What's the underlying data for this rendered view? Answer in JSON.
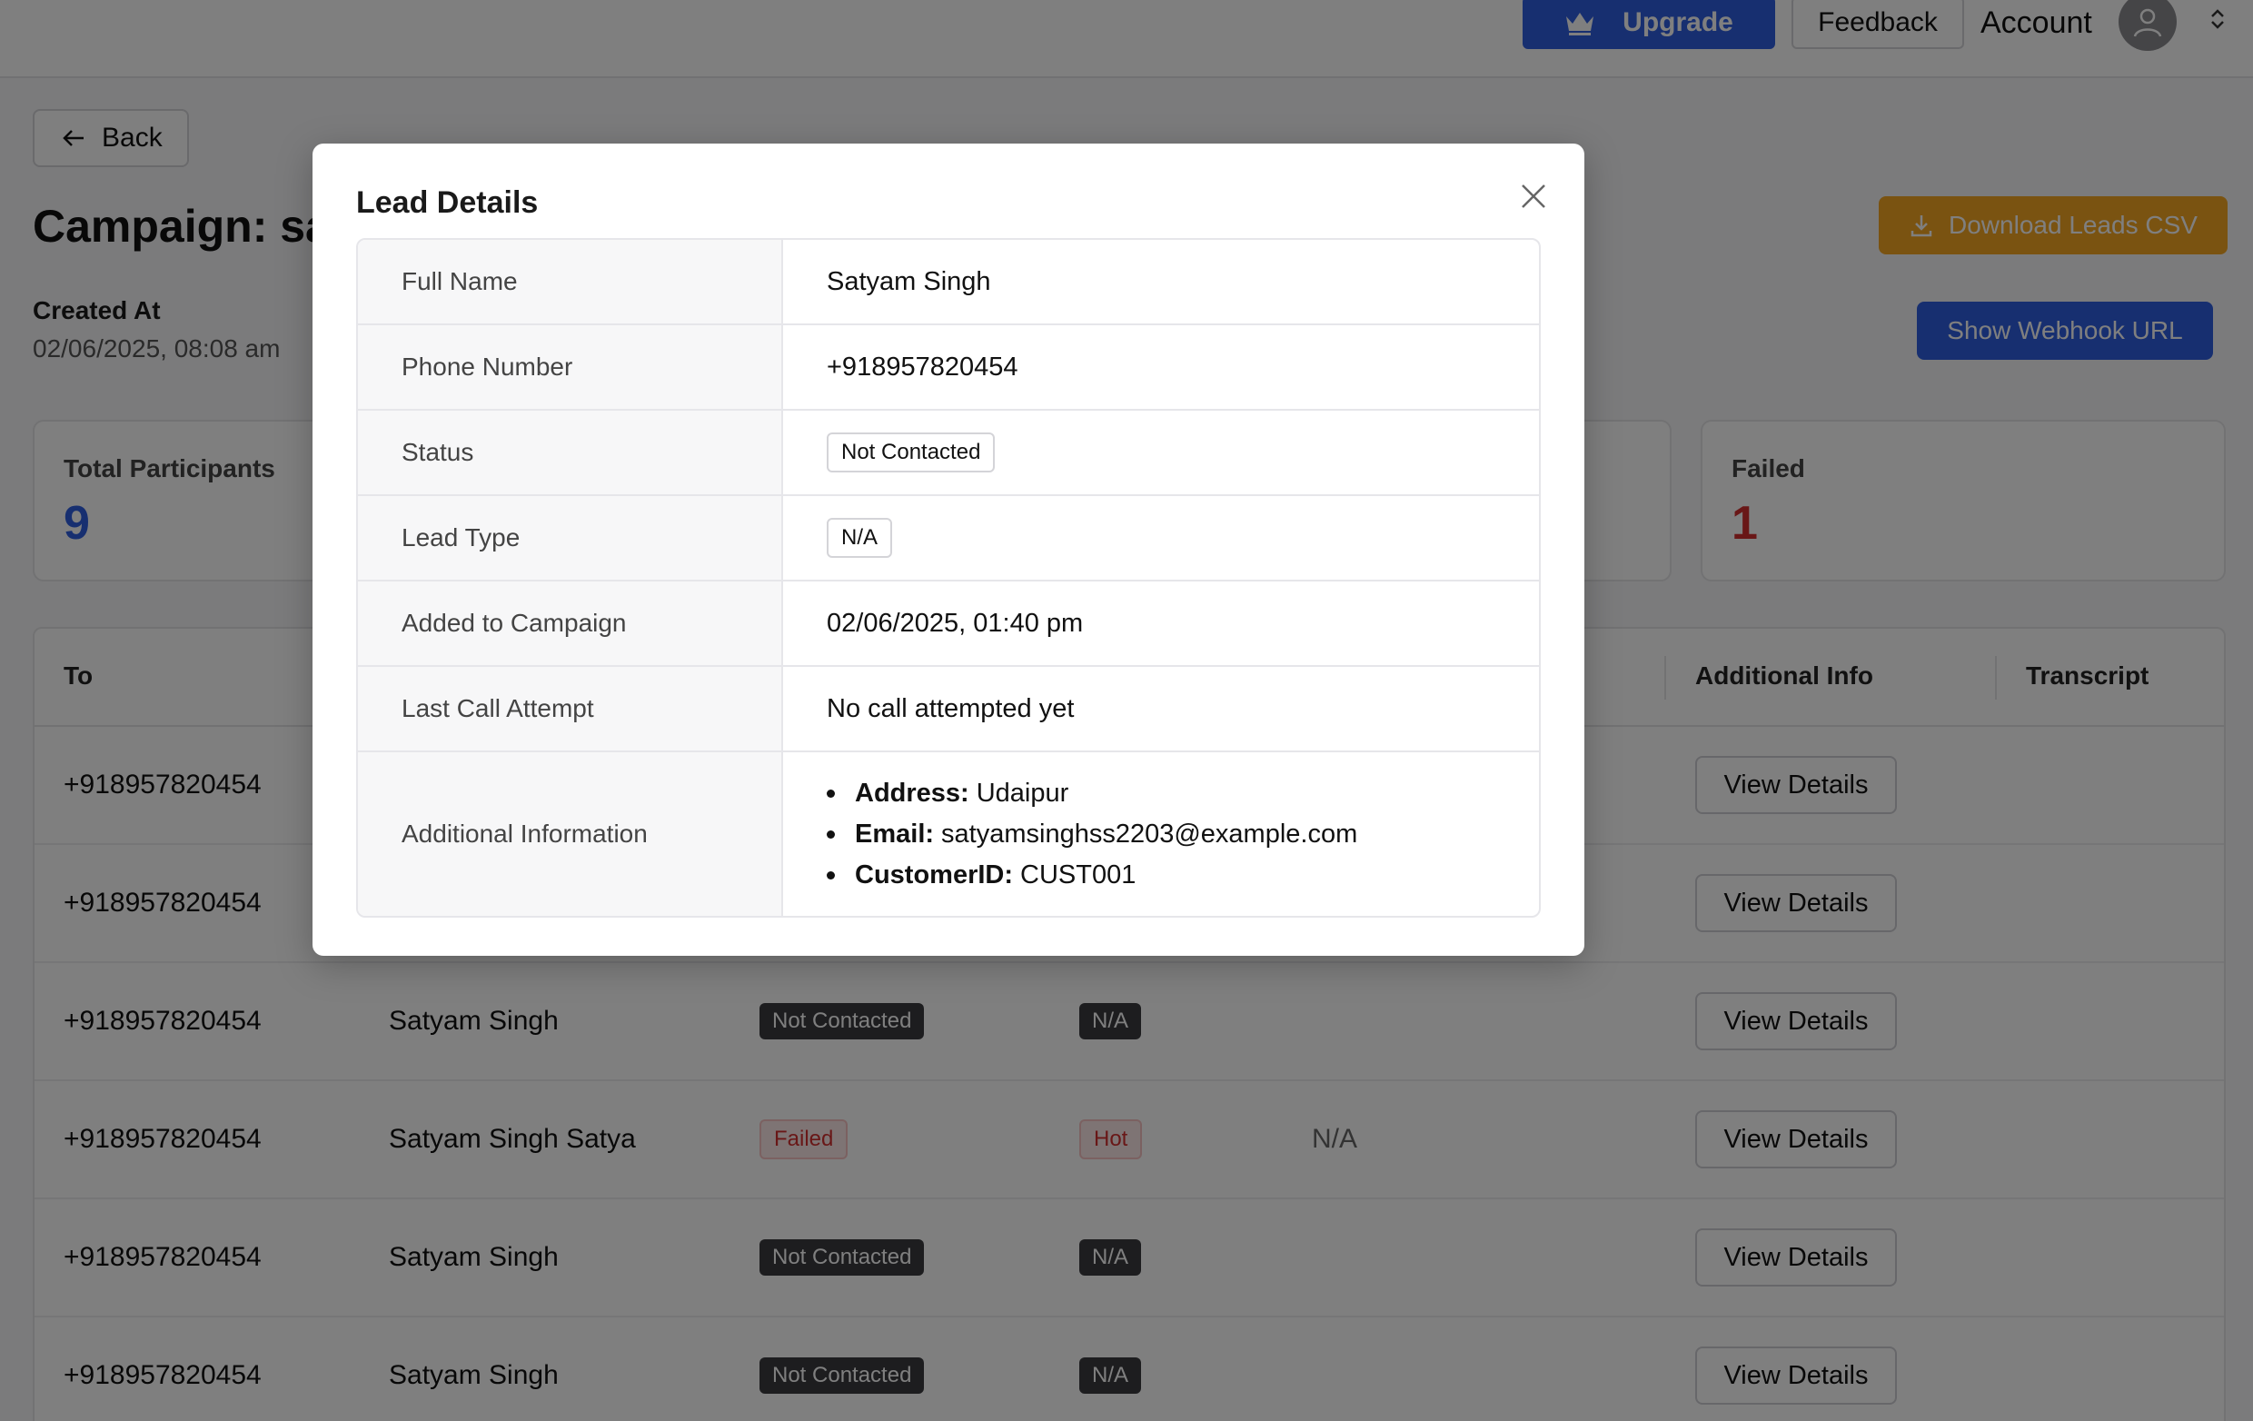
{
  "header": {
    "upgrade_label": "Upgrade",
    "feedback_label": "Feedback",
    "account_label": "Account"
  },
  "page": {
    "back_label": "Back",
    "title": "Campaign: sa",
    "created_at_label": "Created At",
    "created_at_value": "02/06/2025, 08:08 am",
    "download_label": "Download Leads CSV",
    "webhook_label": "Show Webhook URL"
  },
  "stats": {
    "total_label": "Total Participants",
    "total_value": "9",
    "failed_label": "Failed",
    "failed_value": "1"
  },
  "table": {
    "headers": {
      "to": "To",
      "additional_info": "Additional Info",
      "transcript": "Transcript"
    },
    "rows": [
      {
        "to": "+918957820454",
        "name": "",
        "status": "",
        "lead_type": "",
        "extra": "",
        "action": "View Details"
      },
      {
        "to": "+918957820454",
        "name": "",
        "status": "",
        "lead_type": "",
        "extra": "",
        "action": "View Details"
      },
      {
        "to": "+918957820454",
        "name": "Satyam Singh",
        "status": "Not Contacted",
        "lead_type": "N/A",
        "extra": "",
        "action": "View Details"
      },
      {
        "to": "+918957820454",
        "name": "Satyam Singh Satya",
        "status": "Failed",
        "lead_type": "Hot",
        "extra": "N/A",
        "action": "View Details"
      },
      {
        "to": "+918957820454",
        "name": "Satyam Singh",
        "status": "Not Contacted",
        "lead_type": "N/A",
        "extra": "",
        "action": "View Details"
      },
      {
        "to": "+918957820454",
        "name": "Satyam Singh",
        "status": "Not Contacted",
        "lead_type": "N/A",
        "extra": "",
        "action": "View Details"
      }
    ]
  },
  "modal": {
    "title": "Lead Details",
    "rows": [
      {
        "label": "Full Name",
        "value": "Satyam Singh"
      },
      {
        "label": "Phone Number",
        "value": "+918957820454"
      },
      {
        "label": "Status",
        "value": "Not Contacted"
      },
      {
        "label": "Lead Type",
        "value": "N/A"
      },
      {
        "label": "Added to Campaign",
        "value": "02/06/2025, 01:40 pm"
      },
      {
        "label": "Last Call Attempt",
        "value": "No call attempted yet"
      },
      {
        "label": "Additional Information",
        "value": ""
      }
    ],
    "additional_info": [
      {
        "key": "Address:",
        "value": "Udaipur"
      },
      {
        "key": "Email:",
        "value": "satyamsinghss2203@example.com"
      },
      {
        "key": "CustomerID:",
        "value": "CUST001"
      }
    ]
  },
  "icons": {
    "upgrade": "crown-icon",
    "avatar": "user-icon",
    "account_menu": "chevron-updown-icon",
    "back": "arrow-left-icon",
    "download": "download-icon",
    "close": "close-icon"
  },
  "colors": {
    "primary": "#2f5fe0",
    "download": "#f5a623",
    "failed": "#d22f2f"
  }
}
